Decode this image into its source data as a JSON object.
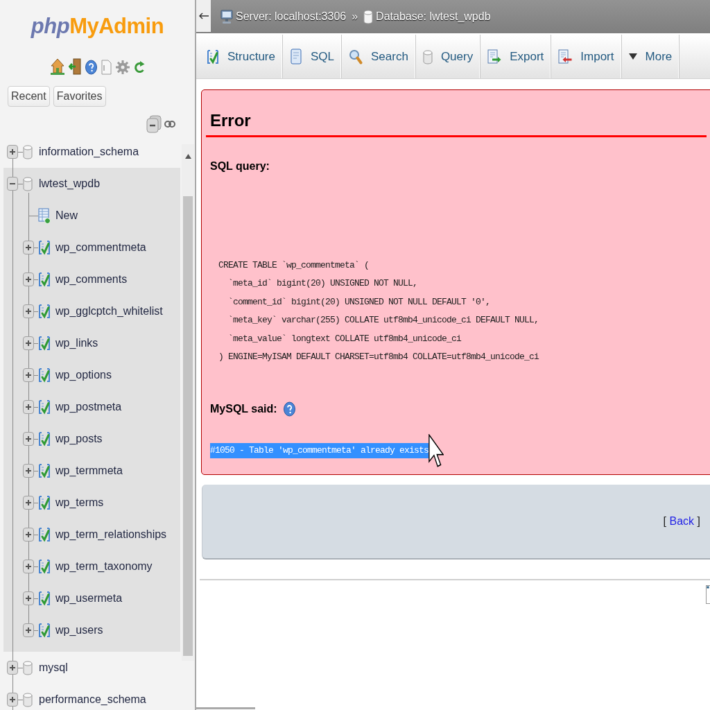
{
  "sidebar": {
    "logo": {
      "prefix": "php",
      "name": "MyAdmin"
    },
    "buttons": [
      "Recent",
      "Favorites"
    ],
    "tree": [
      {
        "name": "information_schema",
        "expanded": false,
        "selected": false
      },
      {
        "name": "lwtest_wpdb",
        "expanded": true,
        "selected": true,
        "children": [
          {
            "name": "New",
            "kind": "new"
          },
          {
            "name": "wp_commentmeta",
            "kind": "table",
            "expanded": false
          },
          {
            "name": "wp_comments",
            "kind": "table",
            "expanded": false
          },
          {
            "name": "wp_gglcptch_whitelist",
            "kind": "table",
            "expanded": false
          },
          {
            "name": "wp_links",
            "kind": "table",
            "expanded": false
          },
          {
            "name": "wp_options",
            "kind": "table",
            "expanded": false
          },
          {
            "name": "wp_postmeta",
            "kind": "table",
            "expanded": false
          },
          {
            "name": "wp_posts",
            "kind": "table",
            "expanded": false
          },
          {
            "name": "wp_termmeta",
            "kind": "table",
            "expanded": false
          },
          {
            "name": "wp_terms",
            "kind": "table",
            "expanded": false
          },
          {
            "name": "wp_term_relationships",
            "kind": "table",
            "expanded": false
          },
          {
            "name": "wp_term_taxonomy",
            "kind": "table",
            "expanded": false
          },
          {
            "name": "wp_usermeta",
            "kind": "table",
            "expanded": false
          },
          {
            "name": "wp_users",
            "kind": "table",
            "expanded": false
          }
        ]
      },
      {
        "name": "mysql",
        "expanded": false,
        "selected": false
      },
      {
        "name": "performance_schema",
        "expanded": false,
        "selected": false
      }
    ]
  },
  "breadcrumb": {
    "items": [
      {
        "kind": "server",
        "label": "Server: localhost:3306"
      },
      {
        "kind": "database",
        "label": "Database: lwtest_wpdb"
      }
    ],
    "separator": "»"
  },
  "tabs": [
    {
      "label": "Structure",
      "kind": "structure",
      "selected": false
    },
    {
      "label": "SQL",
      "kind": "sql",
      "selected": false
    },
    {
      "label": "Search",
      "kind": "search",
      "selected": false
    },
    {
      "label": "Query",
      "kind": "query",
      "selected": false
    },
    {
      "label": "Export",
      "kind": "export",
      "selected": false
    },
    {
      "label": "Import",
      "kind": "import",
      "selected": false
    },
    {
      "label": "More",
      "kind": "more",
      "selected": false
    }
  ],
  "error": {
    "title": "Error",
    "query_label": "SQL query:",
    "query_lines": [
      "CREATE TABLE `wp_commentmeta` (",
      "  `meta_id` bigint(20) UNSIGNED NOT NULL,",
      "  `comment_id` bigint(20) UNSIGNED NOT NULL DEFAULT '0',",
      "  `meta_key` varchar(255) COLLATE utf8mb4_unicode_ci DEFAULT NULL,",
      "  `meta_value` longtext COLLATE utf8mb4_unicode_ci",
      ") ENGINE=MyISAM DEFAULT CHARSET=utf8mb4 COLLATE=utf8mb4_unicode_ci"
    ],
    "said_label": "MySQL said:",
    "message": {
      "text": "#1050 - Table 'wp_commentmeta' already exists",
      "highlighted": true
    }
  },
  "back_link": {
    "open": "[",
    "label": "Back",
    "close": "]"
  }
}
